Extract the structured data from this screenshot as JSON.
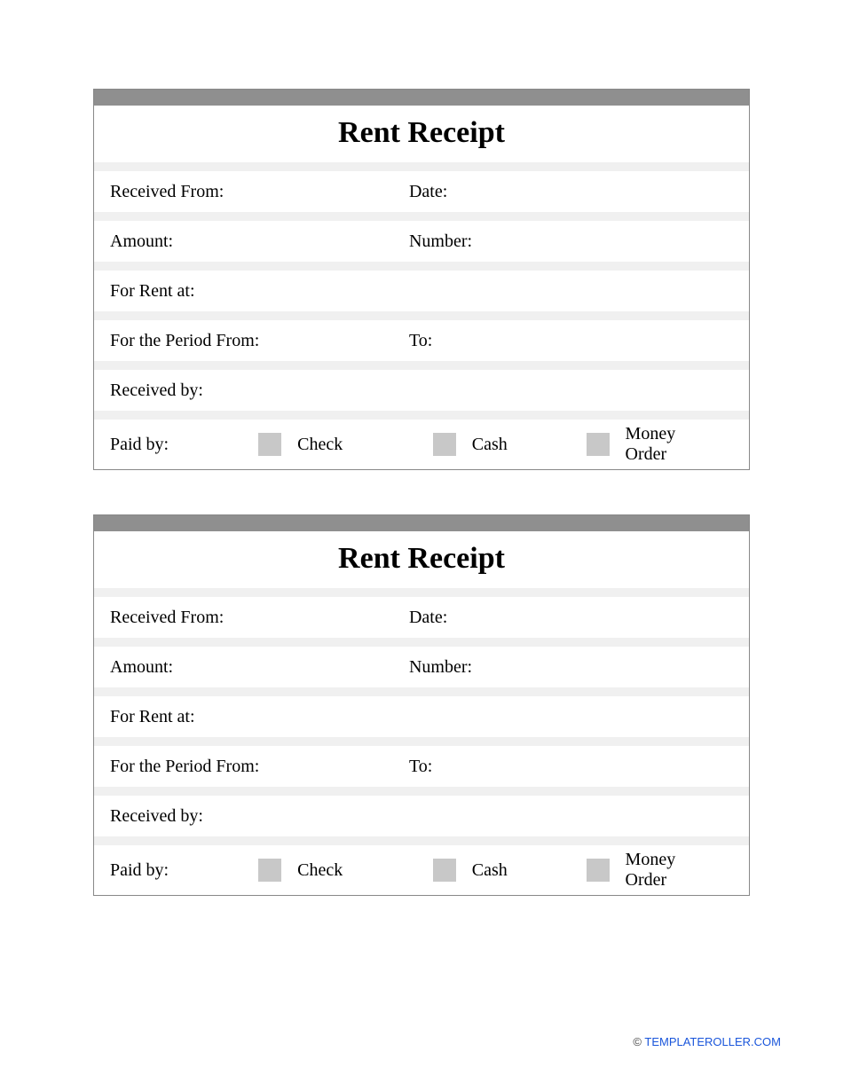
{
  "receipt": {
    "title": "Rent Receipt",
    "fields": {
      "received_from": "Received From:",
      "date": "Date:",
      "amount": "Amount:",
      "number": "Number:",
      "for_rent_at": "For Rent at:",
      "period_from": "For the Period From:",
      "period_to": "To:",
      "received_by": "Received by:",
      "paid_by": "Paid by:"
    },
    "payment_options": {
      "check": "Check",
      "cash": "Cash",
      "money_order": "Money Order"
    }
  },
  "footer": {
    "copyright": "©",
    "link_text": "TEMPLATEROLLER.COM"
  }
}
